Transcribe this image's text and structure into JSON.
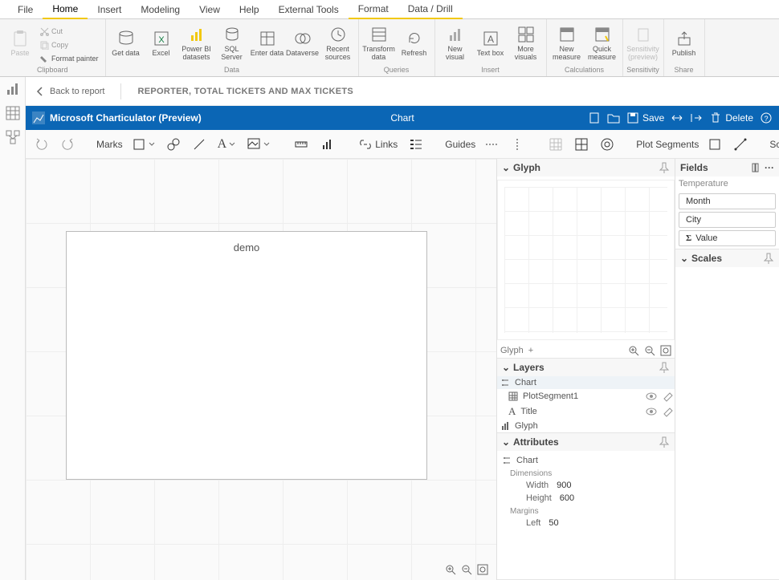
{
  "menu": {
    "tabs": [
      "File",
      "Home",
      "Insert",
      "Modeling",
      "View",
      "Help",
      "External Tools",
      "Format",
      "Data / Drill"
    ],
    "active": [
      1,
      7,
      8
    ]
  },
  "ribbon": {
    "clipboard": {
      "paste": "Paste",
      "cut": "Cut",
      "copy": "Copy",
      "painter": "Format painter",
      "label": "Clipboard"
    },
    "data": {
      "items": [
        "Get data",
        "Excel",
        "Power BI datasets",
        "SQL Server",
        "Enter data",
        "Dataverse",
        "Recent sources"
      ],
      "label": "Data"
    },
    "queries": {
      "items": [
        "Transform data",
        "Refresh"
      ],
      "label": "Queries"
    },
    "insert": {
      "items": [
        "New visual",
        "Text box",
        "More visuals"
      ],
      "label": "Insert"
    },
    "calc": {
      "items": [
        "New measure",
        "Quick measure"
      ],
      "label": "Calculations"
    },
    "sens": {
      "items": [
        "Sensitivity (preview)"
      ],
      "label": "Sensitivity"
    },
    "share": {
      "items": [
        "Publish"
      ],
      "label": "Share"
    }
  },
  "breadcrumb": {
    "back": "Back to report",
    "crumb": "REPORTER, TOTAL TICKETS AND MAX TICKETS"
  },
  "bluebar": {
    "app": "Microsoft Charticulator (Preview)",
    "center": "Chart",
    "save": "Save",
    "delete": "Delete"
  },
  "toolbar": {
    "marks": "Marks",
    "links": "Links",
    "guides": "Guides",
    "plotseg": "Plot Segments",
    "scaffolds": "Scaffolds"
  },
  "canvas": {
    "title": "demo"
  },
  "glyph": {
    "title": "Glyph",
    "footer": "Glyph"
  },
  "layers": {
    "title": "Layers",
    "root": "Chart",
    "items": [
      {
        "name": "PlotSegment1",
        "icon": "grid"
      },
      {
        "name": "Title",
        "icon": "text"
      }
    ],
    "glyph": "Glyph"
  },
  "attributes": {
    "title": "Attributes",
    "root": "Chart",
    "dimensions_label": "Dimensions",
    "width_label": "Width",
    "width": "900",
    "height_label": "Height",
    "height": "600",
    "margins_label": "Margins",
    "left_label": "Left",
    "left": "50"
  },
  "fields": {
    "title": "Fields",
    "group": "Temperature",
    "items": [
      {
        "name": "Month",
        "agg": false
      },
      {
        "name": "City",
        "agg": false
      },
      {
        "name": "Value",
        "agg": true
      }
    ]
  },
  "scales": {
    "title": "Scales"
  }
}
